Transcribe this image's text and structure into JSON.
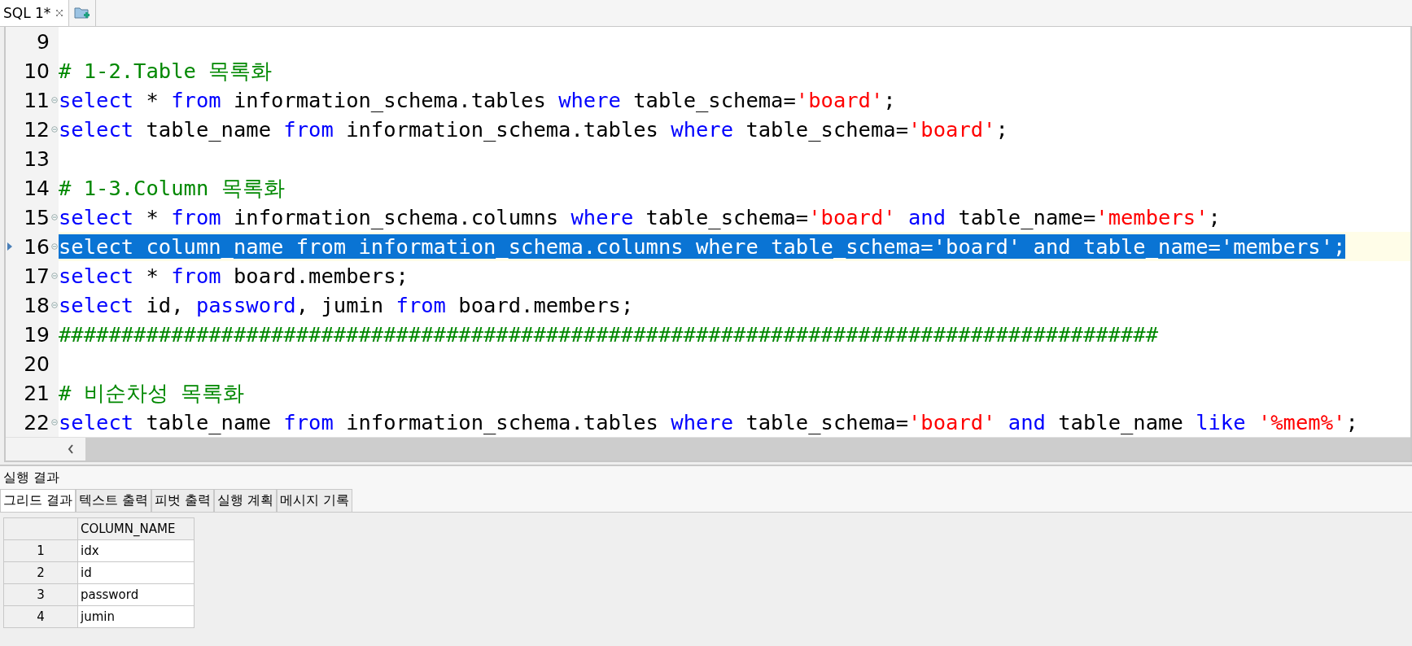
{
  "editor_tabs": [
    {
      "label": "SQL 1*",
      "selected": true,
      "closable": true
    }
  ],
  "editor": {
    "lines": [
      {
        "number": "9",
        "foldable": false,
        "selected": false
      },
      {
        "number": "10",
        "foldable": false,
        "selected": false,
        "tokens": [
          {
            "text": "# 1-2.Table 목록화",
            "kind": "comment"
          }
        ]
      },
      {
        "number": "11",
        "foldable": true,
        "selected": false,
        "tokens": [
          {
            "text": "select",
            "kind": "keyword"
          },
          {
            "text": " * ",
            "kind": "plain"
          },
          {
            "text": "from",
            "kind": "keyword"
          },
          {
            "text": " information_schema.tables ",
            "kind": "plain"
          },
          {
            "text": "where",
            "kind": "keyword"
          },
          {
            "text": " table_schema=",
            "kind": "plain"
          },
          {
            "text": "'board'",
            "kind": "string"
          },
          {
            "text": ";",
            "kind": "plain"
          }
        ]
      },
      {
        "number": "12",
        "foldable": true,
        "selected": false,
        "tokens": [
          {
            "text": "select",
            "kind": "keyword"
          },
          {
            "text": " table_name ",
            "kind": "plain"
          },
          {
            "text": "from",
            "kind": "keyword"
          },
          {
            "text": " information_schema.tables ",
            "kind": "plain"
          },
          {
            "text": "where",
            "kind": "keyword"
          },
          {
            "text": " table_schema=",
            "kind": "plain"
          },
          {
            "text": "'board'",
            "kind": "string"
          },
          {
            "text": ";",
            "kind": "plain"
          }
        ]
      },
      {
        "number": "13",
        "foldable": false,
        "selected": false
      },
      {
        "number": "14",
        "foldable": false,
        "selected": false,
        "tokens": [
          {
            "text": "# 1-3.Column 목록화",
            "kind": "comment"
          }
        ]
      },
      {
        "number": "15",
        "foldable": true,
        "selected": false,
        "tokens": [
          {
            "text": "select",
            "kind": "keyword"
          },
          {
            "text": " * ",
            "kind": "plain"
          },
          {
            "text": "from",
            "kind": "keyword"
          },
          {
            "text": " information_schema.columns ",
            "kind": "plain"
          },
          {
            "text": "where",
            "kind": "keyword"
          },
          {
            "text": " table_schema=",
            "kind": "plain"
          },
          {
            "text": "'board' ",
            "kind": "string"
          },
          {
            "text": "and",
            "kind": "keyword"
          },
          {
            "text": " table_name=",
            "kind": "plain"
          },
          {
            "text": "'members'",
            "kind": "string"
          },
          {
            "text": ";",
            "kind": "plain"
          }
        ]
      },
      {
        "number": "16",
        "foldable": true,
        "selected": true,
        "tokens": [
          {
            "text": "select",
            "kind": "keyword"
          },
          {
            "text": " column_name ",
            "kind": "plain"
          },
          {
            "text": "from",
            "kind": "keyword"
          },
          {
            "text": " information_schema.columns ",
            "kind": "plain"
          },
          {
            "text": "where",
            "kind": "keyword"
          },
          {
            "text": " table_schema=",
            "kind": "plain"
          },
          {
            "text": "'board' ",
            "kind": "string"
          },
          {
            "text": "and",
            "kind": "keyword"
          },
          {
            "text": " table_name=",
            "kind": "plain"
          },
          {
            "text": "'members'",
            "kind": "string"
          },
          {
            "text": ";",
            "kind": "plain"
          }
        ]
      },
      {
        "number": "17",
        "foldable": true,
        "selected": false,
        "tokens": [
          {
            "text": "select",
            "kind": "keyword"
          },
          {
            "text": " * ",
            "kind": "plain"
          },
          {
            "text": "from",
            "kind": "keyword"
          },
          {
            "text": " board.members;",
            "kind": "plain"
          }
        ]
      },
      {
        "number": "18",
        "foldable": true,
        "selected": false,
        "tokens": [
          {
            "text": "select",
            "kind": "keyword"
          },
          {
            "text": " id, ",
            "kind": "plain"
          },
          {
            "text": "password",
            "kind": "keyword"
          },
          {
            "text": ", jumin ",
            "kind": "plain"
          },
          {
            "text": "from",
            "kind": "keyword"
          },
          {
            "text": " board.members;",
            "kind": "plain"
          }
        ]
      },
      {
        "number": "19",
        "foldable": false,
        "selected": false,
        "tokens": [
          {
            "text": "########################################################################################",
            "kind": "comment"
          }
        ]
      },
      {
        "number": "20",
        "foldable": false,
        "selected": false
      },
      {
        "number": "21",
        "foldable": false,
        "selected": false,
        "tokens": [
          {
            "text": "# 비순차성 목록화",
            "kind": "comment"
          }
        ]
      },
      {
        "number": "22",
        "foldable": true,
        "selected": false,
        "tokens": [
          {
            "text": "select",
            "kind": "keyword"
          },
          {
            "text": " table_name ",
            "kind": "plain"
          },
          {
            "text": "from",
            "kind": "keyword"
          },
          {
            "text": " information_schema.tables ",
            "kind": "plain"
          },
          {
            "text": "where",
            "kind": "keyword"
          },
          {
            "text": " table_schema=",
            "kind": "plain"
          },
          {
            "text": "'board' ",
            "kind": "string"
          },
          {
            "text": "and",
            "kind": "keyword"
          },
          {
            "text": " table_name ",
            "kind": "plain"
          },
          {
            "text": "like",
            "kind": "keyword"
          },
          {
            "text": " '%mem%'",
            "kind": "string"
          },
          {
            "text": ";",
            "kind": "plain"
          }
        ]
      }
    ]
  },
  "results": {
    "title": "실행 결과",
    "tabs": [
      {
        "label": "그리드 결과",
        "selected": true
      },
      {
        "label": "텍스트 출력",
        "selected": false
      },
      {
        "label": "피벗 출력",
        "selected": false
      },
      {
        "label": "실행 계획",
        "selected": false
      },
      {
        "label": "메시지 기록",
        "selected": false
      }
    ],
    "grid": {
      "columns": [
        "COLUMN_NAME"
      ],
      "rows": [
        {
          "number": "1",
          "cells": [
            "idx"
          ]
        },
        {
          "number": "2",
          "cells": [
            "id"
          ]
        },
        {
          "number": "3",
          "cells": [
            "password"
          ]
        },
        {
          "number": "4",
          "cells": [
            "jumin"
          ]
        }
      ]
    }
  }
}
